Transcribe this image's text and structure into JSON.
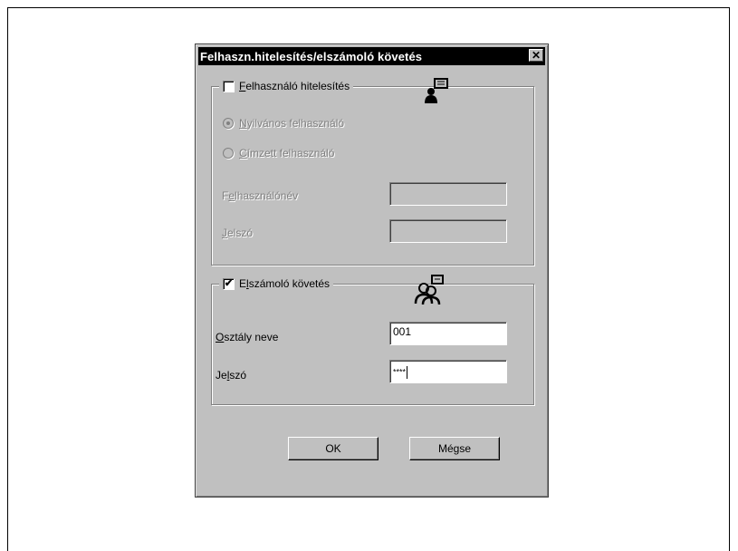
{
  "dialog": {
    "title": "Felhaszn.hitelesítés/elszámoló követés",
    "close_glyph": "✕"
  },
  "auth_group": {
    "checkbox_label_first": "F",
    "checkbox_label_rest": "elhasználó hitelesítés",
    "checked": false,
    "icon": "user-auth-icon",
    "radio_public_first": "N",
    "radio_public_rest": "yilvános felhasználó",
    "radio_public_selected": true,
    "radio_recipient_first": "C",
    "radio_recipient_rest": "ímzett felhasználó",
    "username_label_a": "F",
    "username_label_b": "e",
    "username_label_c": "lhasználónév",
    "username_value": "",
    "password_label_first": "J",
    "password_label_rest": "elszó",
    "password_value": ""
  },
  "account_group": {
    "checkbox_label_a": "E",
    "checkbox_label_b": "l",
    "checkbox_label_c": "számoló követés",
    "checked": true,
    "check_glyph": "✔",
    "icon": "account-tracking-icon",
    "dept_label_first": "O",
    "dept_label_rest": "sztály neve",
    "dept_value": "001",
    "password_label_a": "Je",
    "password_label_b": "l",
    "password_label_c": "szó",
    "password_value": "****"
  },
  "buttons": {
    "ok": "OK",
    "cancel": "Mégse"
  },
  "colors": {
    "face": "#c0c0c0",
    "titlebar": "#000000",
    "disabled_text": "#808080"
  }
}
